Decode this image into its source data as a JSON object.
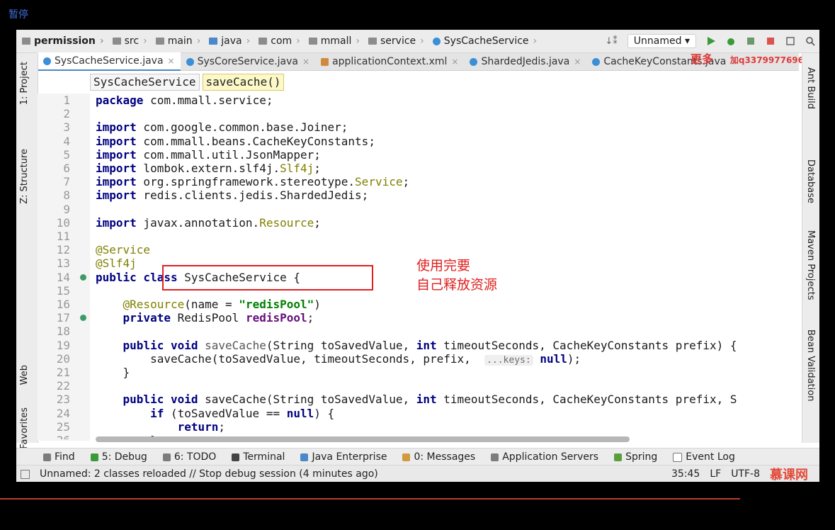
{
  "overlay": {
    "pause_label": "暂停"
  },
  "nav": {
    "crumbs": [
      "permission",
      "src",
      "main",
      "java",
      "com",
      "mmall",
      "service",
      "SysCacheService"
    ],
    "run_config": "Unnamed"
  },
  "tabs": [
    {
      "label": "SysCacheService.java",
      "active": true
    },
    {
      "label": "SysCoreService.java",
      "active": false
    },
    {
      "label": "applicationContext.xml",
      "active": false
    },
    {
      "label": "ShardedJedis.java",
      "active": false
    },
    {
      "label": "CacheKeyConstants.java",
      "active": false
    }
  ],
  "watermark": {
    "big": "更多",
    "text": "加q3379977696"
  },
  "left_sidebar": {
    "project": "1: Project",
    "structure": "Z: Structure",
    "web": "Web",
    "favorites": "2: Favorites"
  },
  "right_sidebar": {
    "ant": "Ant Build",
    "database": "Database",
    "maven": "Maven Projects",
    "bean": "Bean Validation"
  },
  "editor_breadcrumb": {
    "class": "SysCacheService",
    "method": "saveCache()"
  },
  "code_lines": [
    "1",
    "2",
    "3",
    "4",
    "5",
    "6",
    "7",
    "8",
    "9",
    "10",
    "11",
    "12",
    "13",
    "14",
    "15",
    "16",
    "17",
    "18",
    "19",
    "20",
    "21",
    "22",
    "23",
    "24",
    "25",
    "26"
  ],
  "code": {
    "l1": {
      "kw": "package",
      "rest": " com.mmall.service;"
    },
    "l3": {
      "kw": "import",
      "rest": " com.google.common.base.Joiner;"
    },
    "l4": {
      "kw": "import",
      "rest": " com.mmall.beans.CacheKeyConstants;"
    },
    "l5": {
      "kw": "import",
      "rest": " com.mmall.util.JsonMapper;"
    },
    "l6": {
      "kw": "import",
      "rest": " lombok.extern.slf4j.",
      "an": "Slf4j",
      "end": ";"
    },
    "l7": {
      "kw": "import",
      "rest": " org.springframework.stereotype.",
      "an": "Service",
      "end": ";"
    },
    "l8": {
      "kw": "import",
      "rest": " redis.clients.jedis.ShardedJedis;"
    },
    "l10": {
      "kw": "import",
      "rest": " javax.annotation.",
      "an": "Resource",
      "end": ";"
    },
    "l12": {
      "an": "@Service"
    },
    "l13": {
      "an": "@Slf4j"
    },
    "l14": {
      "kw": "public class",
      "rest": " SysCacheService {"
    },
    "l16": {
      "an": "@Resource",
      "a": "(name = ",
      "str": "\"redisPool\"",
      "b": ")"
    },
    "l17": {
      "kw": "private",
      "a": " RedisPool ",
      "fd": "redisPool",
      "b": ";"
    },
    "l19": {
      "kw": "public void",
      "fn": " saveCache",
      "a": "(String toSavedValue, ",
      "kw2": "int",
      "b": " timeoutSeconds, CacheKeyConstants prefix) {"
    },
    "l20": {
      "a": "saveCache(toSavedValue, timeoutSeconds, prefix,  ",
      "hint": "...keys:",
      "kw": " null",
      "b": ");"
    },
    "l21": {
      "a": "}"
    },
    "l23": {
      "kw": "public void",
      "fn": " saveCache",
      "a": "(String toSavedValue, ",
      "kw2": "int",
      "b": " timeoutSeconds, CacheKeyConstants prefix, S"
    },
    "l24": {
      "kw": "if",
      "a": " (toSavedValue == ",
      "kw2": "null",
      "b": ") {"
    },
    "l25": {
      "kw": "return",
      "b": ";"
    },
    "l26": {
      "a": "}"
    }
  },
  "annotation": {
    "text": "使用完要\n自己释放资源",
    "color": "#e02020"
  },
  "tool_windows": [
    "Find",
    "5: Debug",
    "6: TODO",
    "Terminal",
    "Java Enterprise",
    "0: Messages",
    "Application Servers",
    "Spring",
    "Event Log"
  ],
  "status": {
    "message": "Unnamed: 2 classes reloaded // Stop debug session (4 minutes ago)",
    "position": "35:45",
    "line_sep": "LF",
    "encoding": "UTF-8",
    "logo": "慕课网"
  },
  "colors": {
    "keyword": "#000080",
    "annotation": "#808000",
    "string": "#008000",
    "field": "#660e7a"
  }
}
